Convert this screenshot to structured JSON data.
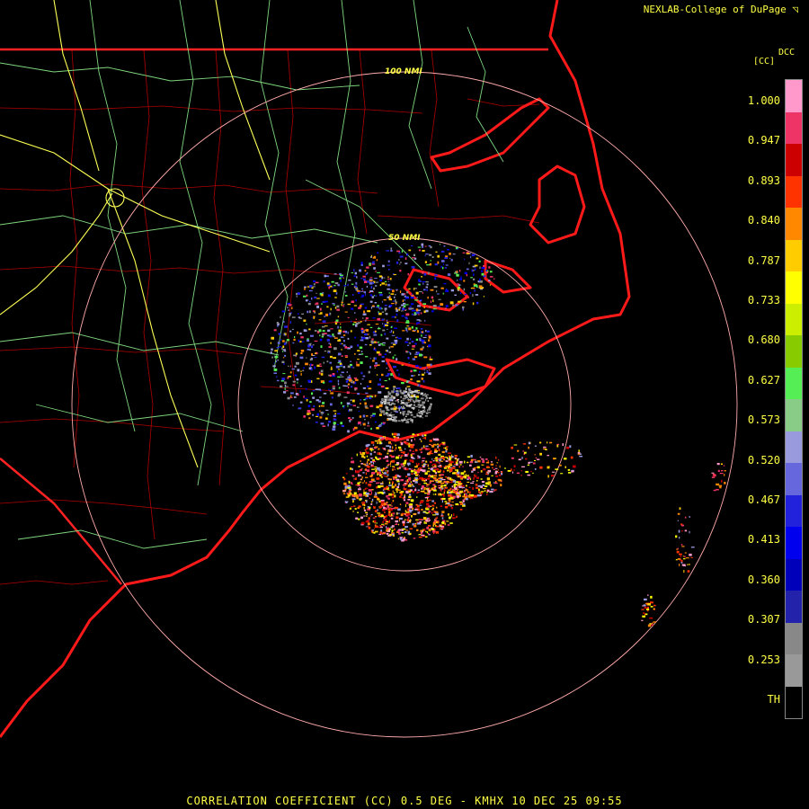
{
  "credit": "NEXLAB-College of DuPage",
  "product": {
    "code": "DCC",
    "unit": "[CC]",
    "footer": "CORRELATION COEFFICIENT (CC) 0.5 DEG - KMHX 10 DEC 25 09:55"
  },
  "range_rings": [
    "50 NMI",
    "100 NMI"
  ],
  "legend": {
    "labels": [
      "1.000",
      "0.947",
      "0.893",
      "0.840",
      "0.787",
      "0.733",
      "0.680",
      "0.627",
      "0.573",
      "0.520",
      "0.467",
      "0.413",
      "0.360",
      "0.307",
      "0.253",
      "TH"
    ],
    "colors": [
      "#ff99cc",
      "#ee3366",
      "#cc0000",
      "#ff3300",
      "#ff8800",
      "#ffcc00",
      "#ffff00",
      "#ccee00",
      "#88cc00",
      "#55ee55",
      "#88cc88",
      "#9999dd",
      "#6666dd",
      "#2222dd",
      "#0000ee",
      "#0000bb",
      "#2222aa",
      "#888888",
      "#999999",
      "#000000"
    ]
  },
  "colors": {
    "background": "#000000",
    "state_border": "#ff2222",
    "county_border": "#aa0000",
    "interstate": "#ffff66",
    "highway": "#88dd88",
    "range_ring": "#ffaaaa",
    "text": "#ffff44"
  }
}
